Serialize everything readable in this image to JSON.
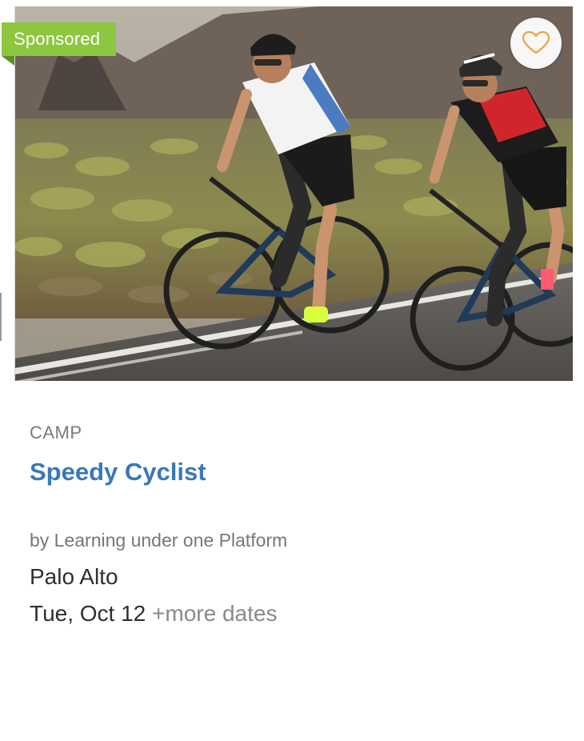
{
  "listing": {
    "badge": "Sponsored",
    "category": "CAMP",
    "title": "Speedy Cyclist",
    "provider": "by Learning under one Platform",
    "location": "Palo Alto",
    "date": "Tue, Oct 12",
    "more_dates": "+more dates",
    "image_subject": "two road cyclists riding on a mountain road",
    "favorite_icon": "heart-outline-icon"
  },
  "colors": {
    "badge_bg": "#8dc63f",
    "title": "#3a78b8",
    "heart": "#f0a03c",
    "muted_text": "#7a7a7a",
    "body_text": "#2f2f2f"
  }
}
